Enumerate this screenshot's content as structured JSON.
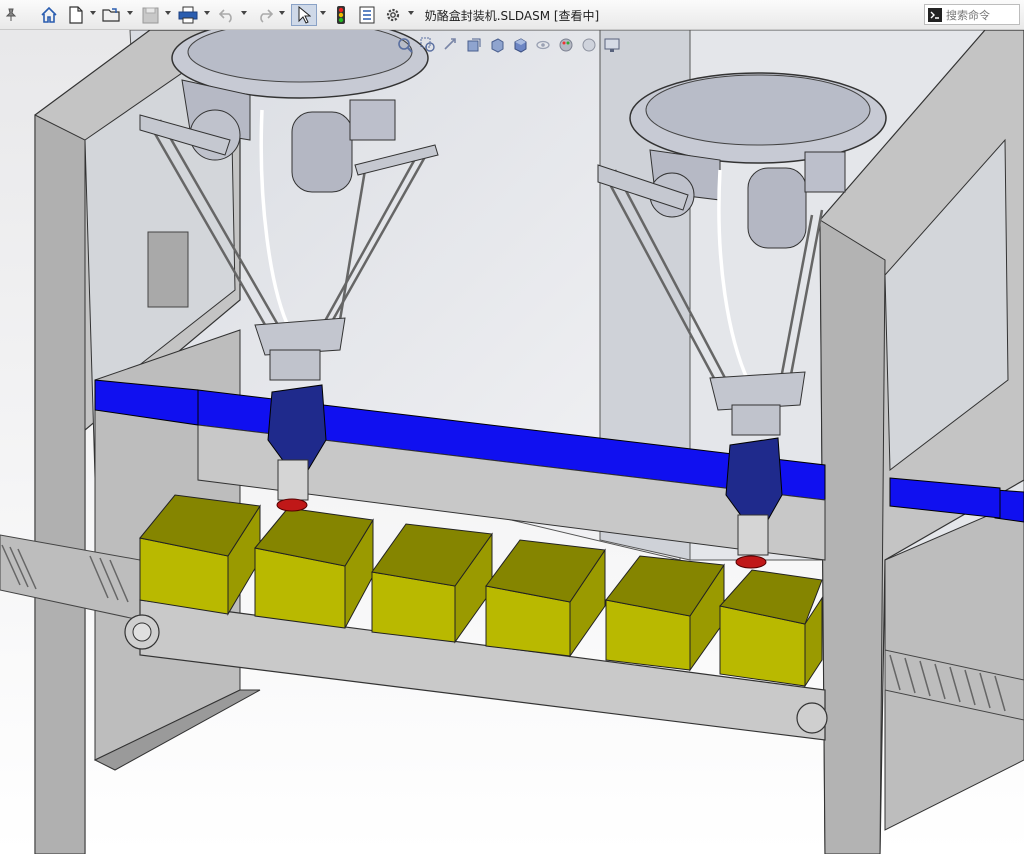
{
  "toolbar": {
    "title": "奶酪盒封装机.SLDASM [查看中]",
    "search_placeholder": "搜索命令",
    "buttons": [
      {
        "name": "pin-icon"
      },
      {
        "name": "home-icon"
      },
      {
        "name": "new-document-icon"
      },
      {
        "name": "open-folder-icon"
      },
      {
        "name": "save-icon"
      },
      {
        "name": "print-icon"
      },
      {
        "name": "undo-icon"
      },
      {
        "name": "redo-icon"
      },
      {
        "name": "select-arrow-icon"
      },
      {
        "name": "traffic-light-icon"
      },
      {
        "name": "file-properties-icon"
      },
      {
        "name": "options-gear-icon"
      }
    ]
  },
  "heads_up": [
    "zoom-to-fit-icon",
    "zoom-to-area-icon",
    "previous-view-icon",
    "section-view-icon",
    "view-orientation-icon",
    "display-style-icon",
    "hide-show-items-icon",
    "edit-appearance-icon",
    "apply-scene-icon",
    "view-settings-icon",
    "display-monitor-icon"
  ],
  "colors": {
    "background_top": "#f6f6f6",
    "frame": "#c9c9c9",
    "frame_dark": "#8f8f8f",
    "conveyor_blue": "#1010f0",
    "box_yellow": "#b9b900",
    "gripper_blue": "#1f2a8c",
    "suction_red": "#c01818"
  },
  "scene": {
    "boxes": 6,
    "delta_robots": 2
  }
}
